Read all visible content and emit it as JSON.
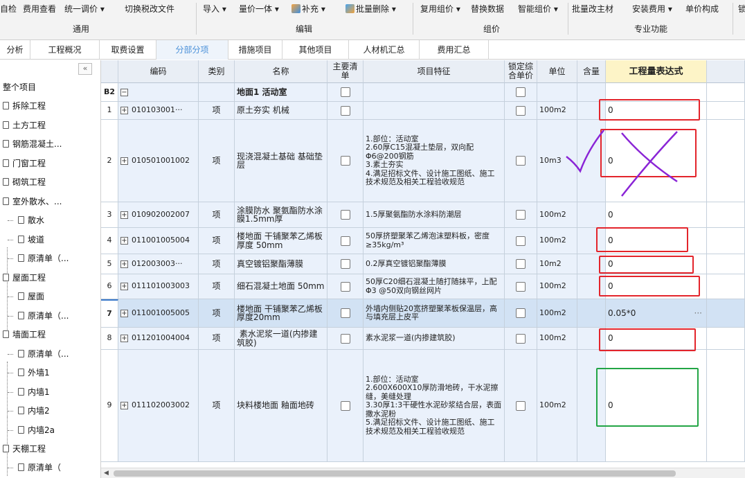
{
  "ribbon": {
    "row_items": [
      "自检",
      "费用查看",
      "统一调价 ▾",
      "切换税改文件",
      "导入 ▾",
      "量价一体 ▾",
      "补充 ▾",
      "批量删除 ▾",
      "复用组价 ▾",
      "替换数据",
      "智能组价 ▾",
      "批量改主材",
      "安装费用 ▾",
      "单价构成",
      "锁"
    ],
    "groups": [
      "通用",
      "编辑",
      "组价",
      "专业功能"
    ]
  },
  "tabs": [
    "分析",
    "工程概况",
    "取费设置",
    "分部分项",
    "措施项目",
    "其他项目",
    "人材机汇总",
    "费用汇总"
  ],
  "active_tab": "分部分项",
  "sidebar": {
    "collapse_label": "«",
    "items": [
      "整个项目",
      "拆除工程",
      "土方工程",
      "钢筋混凝土...",
      "门窗工程",
      "砌筑工程",
      "室外散水、...",
      "散水",
      "坡道",
      "原清单（...",
      "屋面工程",
      "屋面",
      "原清单（...",
      "墙面工程",
      "原清单（...",
      "外墙1",
      "内墙1",
      "内墙2",
      "内墙2a",
      "天棚工程",
      "原清单（"
    ]
  },
  "table": {
    "headers": [
      "",
      "编码",
      "类别",
      "名称",
      "主要清单",
      "项目特征",
      "锁定综合单价",
      "单位",
      "含量",
      "工程量表达式"
    ],
    "group_row": {
      "num": "B2",
      "expand": "−",
      "name": "地面1 活动室"
    },
    "rows": [
      {
        "num": "1",
        "code": "010103001···",
        "type": "项",
        "name": "原土夯实 机械",
        "feature": "",
        "unit": "100m2",
        "expr": "0"
      },
      {
        "num": "2",
        "code": "010501001002",
        "type": "项",
        "name": "现浇混凝土基础 基础垫层",
        "feature": "1.部位：活动室\n2.60厚C15混凝土垫层，双向配Φ6@200钢筋\n3.素土夯实\n4.满足招标文件、设计施工图纸、施工技术规范及相关工程验收规范",
        "unit": "10m3",
        "expr": "0"
      },
      {
        "num": "3",
        "code": "010902002007",
        "type": "项",
        "name": "涂膜防水 聚氨酯防水涂膜1.5mm厚",
        "feature": "1.5厚聚氨酯防水涂料防潮层",
        "unit": "100m2",
        "expr": "0"
      },
      {
        "num": "4",
        "code": "011001005004",
        "type": "项",
        "name": "楼地面 干铺聚苯乙烯板 厚度 50mm",
        "feature": "50厚挤塑聚苯乙烯泡沫塑料板，密度≥35kg/m³",
        "unit": "100m2",
        "expr": "0"
      },
      {
        "num": "5",
        "code": "012003003···",
        "type": "项",
        "name": "真空镀铝聚酯薄膜",
        "feature": "0.2厚真空镀铝聚酯薄膜",
        "unit": "10m2",
        "expr": "0"
      },
      {
        "num": "6",
        "code": "011101003003",
        "type": "项",
        "name": "细石混凝土地面 50mm",
        "feature": "50厚C20细石混凝土随打随抹平，上配Φ3 @50双向钢丝网片",
        "unit": "100m2",
        "expr": "0"
      },
      {
        "num": "7",
        "code": "011001005005",
        "type": "项",
        "name": "楼地面 干铺聚苯乙烯板 厚度20mm",
        "feature": "外墙内侧贴20宽挤塑聚苯板保温层，高与填充层上皮平",
        "unit": "100m2",
        "expr": "0.05*0",
        "more": "···"
      },
      {
        "num": "8",
        "code": "011201004004",
        "type": "项",
        "name": " 素水泥浆一道(内掺建筑胶)",
        "feature": "素水泥浆一道(内掺建筑胶)",
        "unit": "100m2",
        "expr": "0"
      },
      {
        "num": "9",
        "code": "011102003002",
        "type": "项",
        "name": "块料楼地面 釉面地砖",
        "feature": "1.部位：活动室\n2.600X600X10厚防滑地砖，干水泥擦缝，美缝处理\n3.30厚1:3干硬性水泥砂浆结合层，表面撒水泥粉\n5.满足招标文件、设计施工图纸、施工技术规范及相关工程验收规范",
        "unit": "100m2",
        "expr": "0"
      }
    ]
  }
}
